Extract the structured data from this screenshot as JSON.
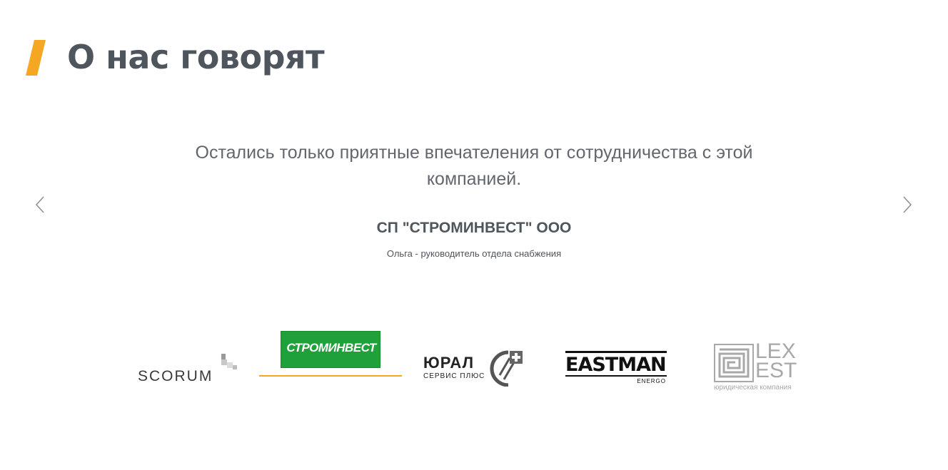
{
  "section": {
    "title": "О нас говорят",
    "accent_color": "#f5a623"
  },
  "testimonial": {
    "quote": "Остались только приятные впечателения от сотрудничества с этой компанией.",
    "company": "СП \"СТРОМИНВЕСТ\" ООО",
    "person": "Ольга - руководитель отдела снабжения"
  },
  "navigation": {
    "prev_icon": "chevron-left-icon",
    "next_icon": "chevron-right-icon"
  },
  "logos": {
    "scorum": {
      "text": "SCORUM"
    },
    "strominvest": {
      "text": "СТРОМИНВЕСТ",
      "color": "#1fa03a",
      "active": true
    },
    "yural": {
      "text": "ЮРАЛ",
      "sub": "СЕРВИС ПЛЮС"
    },
    "eastman": {
      "text": "EASTMAN",
      "sub": "ENERGO"
    },
    "lexest": {
      "line1": "LEX",
      "line2": "EST",
      "sub": "юридическая компания"
    }
  }
}
